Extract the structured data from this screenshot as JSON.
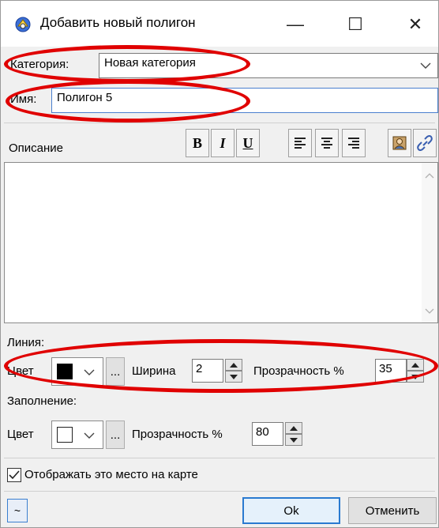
{
  "window": {
    "title": "Добавить новый полигон",
    "icon": "satellite-dish-icon"
  },
  "titlebar_buttons": {
    "minimize": "—",
    "maximize": "☐",
    "close": "✕"
  },
  "category": {
    "label": "Категория:",
    "value": "Новая категория"
  },
  "name": {
    "label": "Имя:",
    "value": "Полигон 5"
  },
  "description": {
    "label": "Описание",
    "value": "",
    "toolbar": {
      "bold": "B",
      "italic": "I",
      "underline": "U",
      "align_left_icon": "align-left-icon",
      "align_center_icon": "align-center-icon",
      "align_right_icon": "align-right-icon",
      "image_icon": "insert-image-icon",
      "link_icon": "insert-link-icon"
    }
  },
  "line": {
    "section_label": "Линия:",
    "color_label": "Цвет",
    "color": "#000000",
    "width_label": "Ширина",
    "width": "2",
    "opacity_label": "Прозрачность %",
    "opacity": "35",
    "more_button": "..."
  },
  "fill": {
    "section_label": "Заполнение:",
    "color_label": "Цвет",
    "color": "#ffffff",
    "opacity_label": "Прозрачность %",
    "opacity": "80",
    "more_button": "..."
  },
  "show_on_map": {
    "checked": true,
    "label": "Отображать это место на карте"
  },
  "footer": {
    "expand_button": "~",
    "ok_button": "Ok",
    "cancel_button": "Отменить"
  },
  "annotations": {
    "color": "#e00000"
  }
}
